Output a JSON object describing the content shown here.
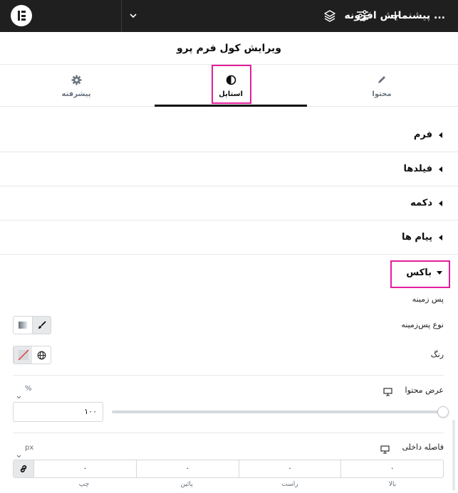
{
  "topbar": {
    "title": "پیشنمایش افزونه ...",
    "icons": [
      "elementor-logo",
      "plus-icon",
      "sliders-icon",
      "layers-icon",
      "chevron-down-icon"
    ]
  },
  "panel": {
    "title": "ویرایش کول فرم پرو"
  },
  "tabs": [
    {
      "label": "محتوا",
      "icon": "pencil-icon"
    },
    {
      "label": "استایل",
      "icon": "half-circle-icon",
      "active": true
    },
    {
      "label": "پیشرفته",
      "icon": "gear-icon"
    }
  ],
  "sections": [
    {
      "label": "فرم"
    },
    {
      "label": "فیلدها"
    },
    {
      "label": "دکمه"
    },
    {
      "label": "پیام ها"
    },
    {
      "label": "باکس",
      "open": true
    }
  ],
  "box": {
    "background_heading": "پس زمینه",
    "background_type_label": "نوع پس‌زمینه",
    "color_label": "رنگ",
    "content_width_label": "عرض محتوا",
    "content_width_unit": "%",
    "content_width_value": "۱۰۰",
    "padding_label": "فاصله داخلی",
    "padding_unit": "px",
    "padding": {
      "top": "۰",
      "right": "۰",
      "bottom": "۰",
      "left": "۰",
      "top_label": "بالا",
      "right_label": "راست",
      "bottom_label": "پائین",
      "left_label": "چپ"
    }
  },
  "colors": {
    "highlight": "#e31e9b",
    "topbar": "#1f1f1f"
  }
}
